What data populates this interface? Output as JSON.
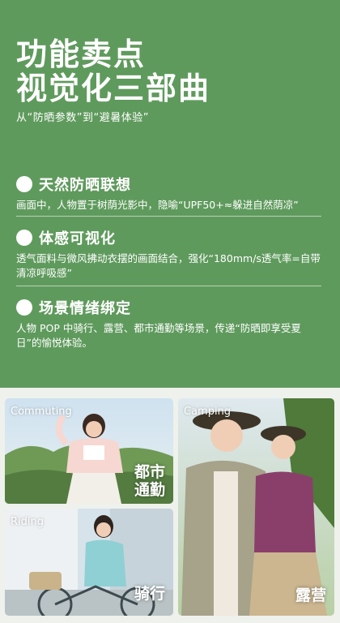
{
  "header": {
    "title_line1": "功能卖点",
    "title_line2": "视觉化三部曲",
    "subtitle": "从“防晒参数”到“避暑体验”"
  },
  "points": [
    {
      "title": "天然防晒联想",
      "desc": "画面中，人物置于树荫光影中，隐喻“UPF50+≈躲进自然荫凉”"
    },
    {
      "title": "体感可视化",
      "desc": "透气面料与微风拂动衣摆的画面结合，强化“180mm/s透气率=自带清凉呼吸感”"
    },
    {
      "title": "场景情绪绑定",
      "desc": "人物 POP 中骑行、露营、都市通勤等场景，传递“防晒即享受夏日”的愉悦体验。"
    }
  ],
  "cards": {
    "commuting": {
      "label": "Commuting",
      "caption_line1": "都市",
      "caption_line2": "通勤"
    },
    "riding": {
      "label": "Riding",
      "caption": "骑行"
    },
    "camping": {
      "label": "Camping",
      "caption": "露营"
    }
  },
  "colors": {
    "background_green": "#5f9a5d",
    "text": "#ffffff"
  }
}
